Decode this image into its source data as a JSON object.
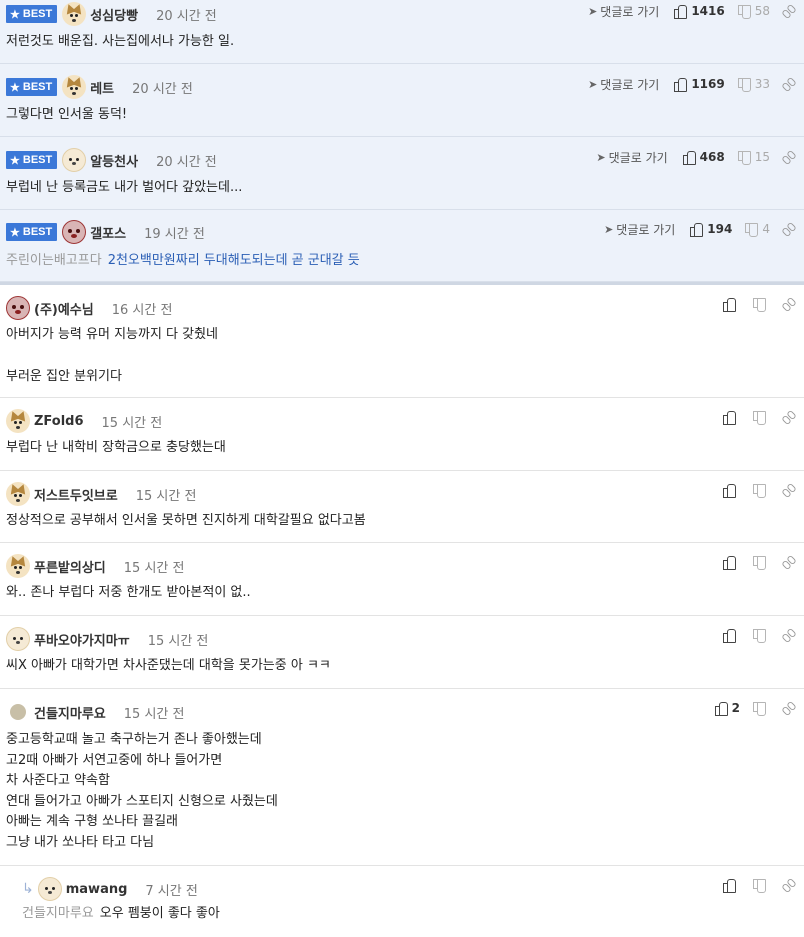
{
  "ui": {
    "best_label": "BEST",
    "reply_link_label": "댓글로 가기"
  },
  "comments": [
    {
      "best": true,
      "avatar": "dog-icon",
      "name": "성심당빵",
      "time": "20 시간 전",
      "show_reply_link": true,
      "likes": "1416",
      "dislikes": "58",
      "lines": [
        "저런것도 배운집. 사는집에서나 가능한 일."
      ]
    },
    {
      "best": true,
      "avatar": "dog-icon",
      "name": "레트",
      "time": "20 시간 전",
      "show_reply_link": true,
      "likes": "1169",
      "dislikes": "33",
      "lines": [
        "그렇다면 인서울 동덕!"
      ]
    },
    {
      "best": true,
      "avatar": "puppy-icon",
      "name": "알등천사",
      "time": "20 시간 전",
      "show_reply_link": true,
      "likes": "468",
      "dislikes": "15",
      "lines": [
        "부럽네 난 등록금도 내가 벌어다 갚았는데..."
      ]
    },
    {
      "best": true,
      "avatar": "red-face-icon",
      "name": "갤포스",
      "time": "19 시간 전",
      "show_reply_link": true,
      "likes": "194",
      "dislikes": "4",
      "mention": "주린이는배고프다",
      "lines": [
        "2천오백만원짜리 두대해도되는데 곧 군대갈 듯"
      ]
    },
    {
      "best": false,
      "avatar": "red-face-icon",
      "name": "(주)예수님",
      "time": "16 시간 전",
      "likes": "",
      "dislikes": "",
      "lines": [
        "아버지가 능력 유머 지능까지 다 갖췄네",
        "",
        "부러운 집안 분위기다"
      ]
    },
    {
      "best": false,
      "avatar": "dog-icon",
      "name": "ZFold6",
      "time": "15 시간 전",
      "likes": "",
      "dislikes": "",
      "lines": [
        "부럽다 난 내학비 장학금으로 충당했는대"
      ]
    },
    {
      "best": false,
      "avatar": "dog-icon",
      "name": "저스트두잇브로",
      "time": "15 시간 전",
      "likes": "",
      "dislikes": "",
      "lines": [
        "정상적으로 공부해서 인서울 못하면 진지하게 대학갈필요 없다고봄"
      ]
    },
    {
      "best": false,
      "avatar": "dog-icon",
      "name": "푸른밭의상디",
      "time": "15 시간 전",
      "likes": "",
      "dislikes": "",
      "lines": [
        "와.. 존나 부럽다 저중 한개도 받아본적이 없.."
      ]
    },
    {
      "best": false,
      "avatar": "puppy-icon",
      "name": "푸바오야가지마ㅠ",
      "time": "15 시간 전",
      "likes": "",
      "dislikes": "",
      "lines": [
        "씨X 아빠가 대학가면 차사준댔는데 대학을 못가는중 아 ㅋㅋ"
      ]
    },
    {
      "best": false,
      "avatar": "dot-icon",
      "name": "건들지마루요",
      "time": "15 시간 전",
      "likes": "2",
      "dislikes": "",
      "lines": [
        "중고등학교때 놀고 축구하는거 존나 좋아했는데",
        "고2때 아빠가 서연고중에 하나 들어가면",
        "차 사준다고 약속함",
        "연대 들어가고 아빠가 스포티지 신형으로 사줬는데",
        "아빠는 계속 구형 쏘나타 끌길래",
        "그냥 내가 쏘나타 타고 다님"
      ]
    },
    {
      "best": false,
      "reply": true,
      "avatar": "puppy-icon",
      "name": "mawang",
      "time": "7 시간 전",
      "likes": "",
      "dislikes": "",
      "mention": "건들지마루요",
      "lines": [
        "오우 펨붕이 좋다 좋아"
      ]
    }
  ]
}
